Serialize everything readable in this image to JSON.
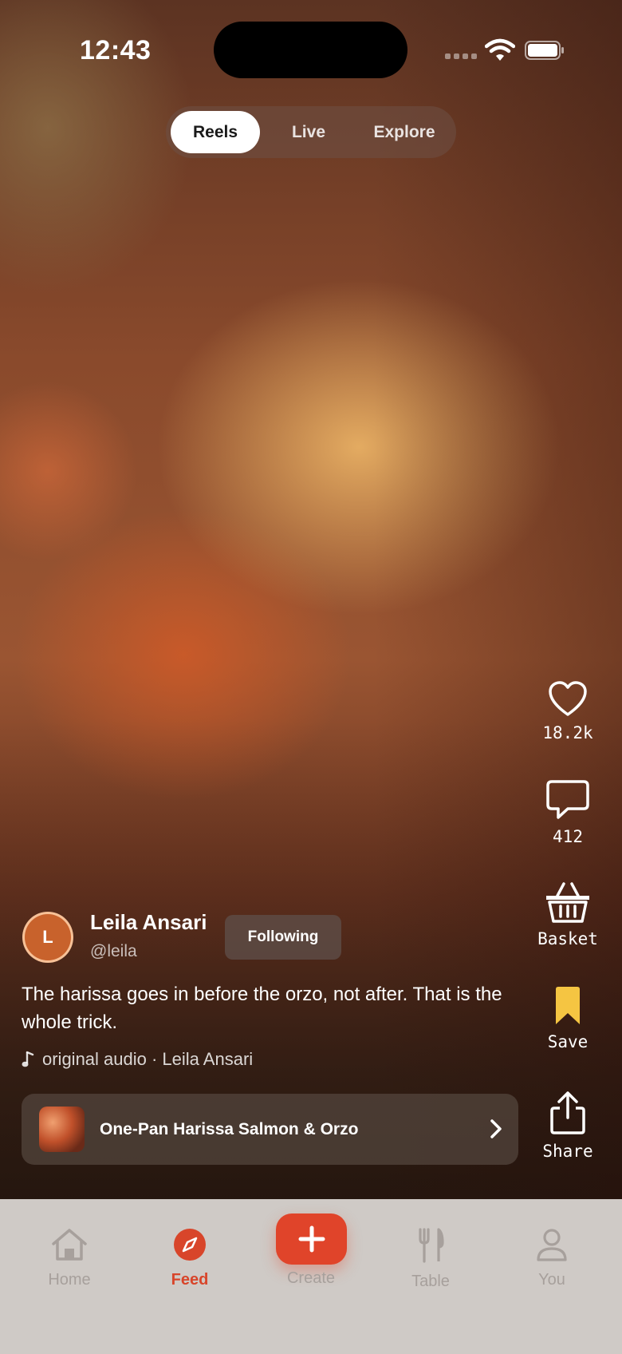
{
  "status_bar": {
    "time": "12:43"
  },
  "top_tabs": [
    {
      "label": "Reels",
      "active": true
    },
    {
      "label": "Live",
      "active": false
    },
    {
      "label": "Explore",
      "active": false
    }
  ],
  "actions": {
    "like": {
      "icon": "heart-icon",
      "count": "18.2k"
    },
    "comment": {
      "icon": "comment-icon",
      "count": "412"
    },
    "basket": {
      "icon": "basket-icon",
      "label": "Basket"
    },
    "save": {
      "icon": "bookmark-icon",
      "label": "Save",
      "color": "#f5c542"
    },
    "share": {
      "icon": "share-icon",
      "label": "Share"
    }
  },
  "author": {
    "initial": "L",
    "name": "Leila Ansari",
    "handle": "@leila",
    "follow_label": "Following"
  },
  "caption": "The harissa goes in before the orzo, not after. That is the whole trick.",
  "audio": {
    "icon": "music-note-icon",
    "label": "original audio · Leila Ansari"
  },
  "recipe": {
    "title": "One-Pan Harissa Salmon & Orzo"
  },
  "tab_bar": {
    "items": [
      {
        "label": "Home",
        "icon": "home-icon"
      },
      {
        "label": "Feed",
        "icon": "compass-icon",
        "active": true
      },
      {
        "label": "Create",
        "icon": "plus-icon"
      },
      {
        "label": "Table",
        "icon": "fork-knife-icon"
      },
      {
        "label": "You",
        "icon": "person-icon"
      }
    ]
  },
  "colors": {
    "accent": "#e0442a",
    "save": "#f5c542"
  }
}
